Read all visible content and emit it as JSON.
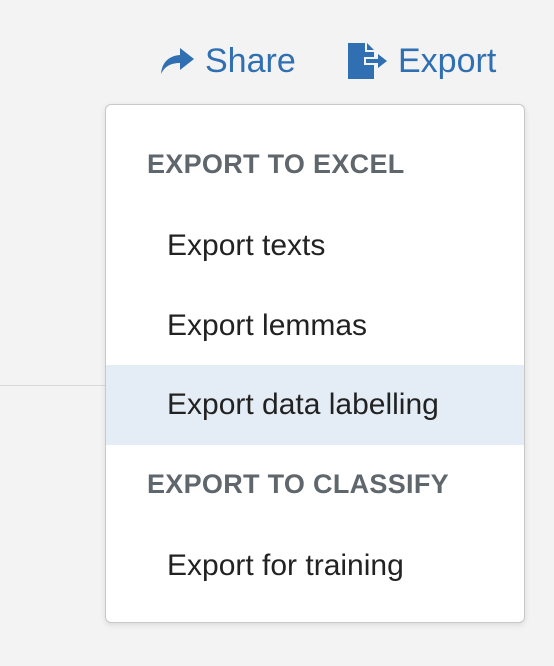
{
  "toolbar": {
    "share_label": "Share",
    "share_icon": "share-arrow-icon",
    "export_label": "Export",
    "export_icon": "file-export-icon",
    "accent_color": "#2f6fb2"
  },
  "export_menu": {
    "sections": [
      {
        "header": "EXPORT TO EXCEL",
        "items": [
          "Export texts",
          "Export lemmas",
          "Export data labelling"
        ]
      },
      {
        "header": "EXPORT TO CLASSIFY",
        "items": [
          "Export for training"
        ]
      }
    ],
    "highlighted_item": "Export data labelling",
    "highlight_color": "#e4ecf5"
  }
}
